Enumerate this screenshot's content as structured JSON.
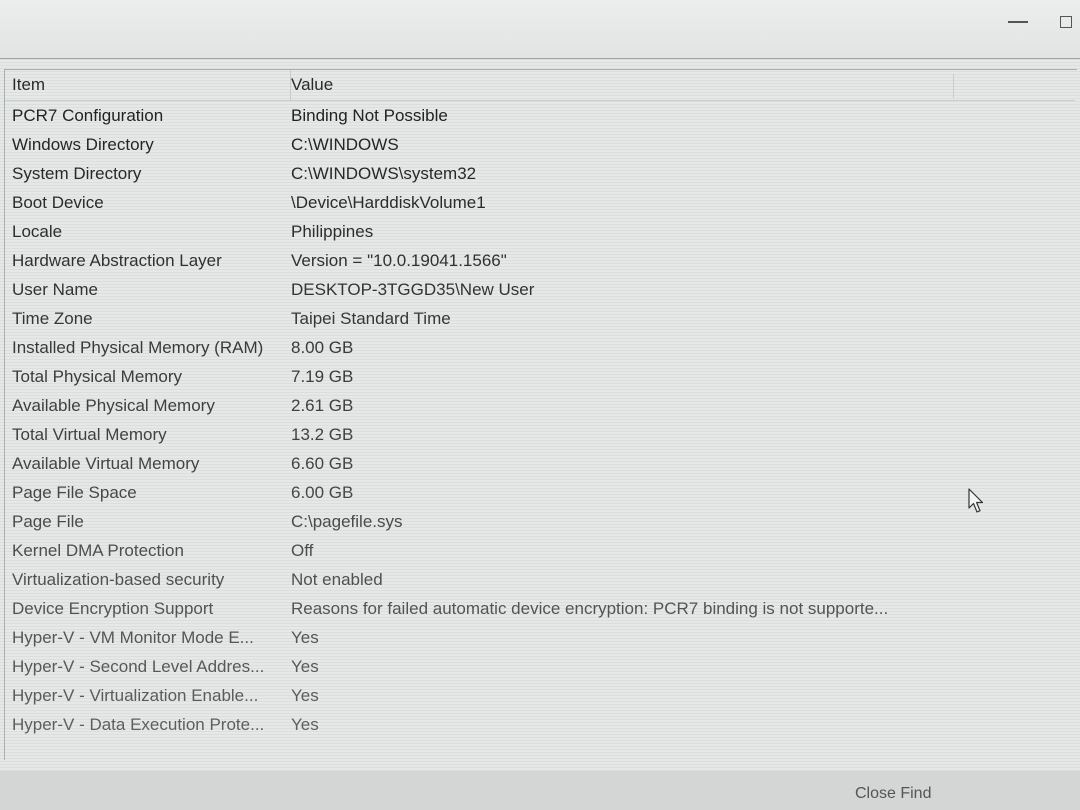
{
  "window": {
    "minimize_icon": "minimize-icon",
    "maximize_icon": "maximize-icon"
  },
  "table": {
    "columns": [
      "Item",
      "Value"
    ],
    "rows": [
      {
        "item": "PCR7 Configuration",
        "value": "Binding Not Possible"
      },
      {
        "item": "Windows Directory",
        "value": "C:\\WINDOWS"
      },
      {
        "item": "System Directory",
        "value": "C:\\WINDOWS\\system32"
      },
      {
        "item": "Boot Device",
        "value": "\\Device\\HarddiskVolume1"
      },
      {
        "item": "Locale",
        "value": "Philippines"
      },
      {
        "item": "Hardware Abstraction Layer",
        "value": "Version = \"10.0.19041.1566\""
      },
      {
        "item": "User Name",
        "value": "DESKTOP-3TGGD35\\New User"
      },
      {
        "item": "Time Zone",
        "value": "Taipei Standard Time"
      },
      {
        "item": "Installed Physical Memory (RAM)",
        "value": "8.00 GB"
      },
      {
        "item": "Total Physical Memory",
        "value": "7.19 GB"
      },
      {
        "item": "Available Physical Memory",
        "value": "2.61 GB"
      },
      {
        "item": "Total Virtual Memory",
        "value": "13.2 GB"
      },
      {
        "item": "Available Virtual Memory",
        "value": "6.60 GB"
      },
      {
        "item": "Page File Space",
        "value": "6.00 GB"
      },
      {
        "item": "Page File",
        "value": "C:\\pagefile.sys"
      },
      {
        "item": "Kernel DMA Protection",
        "value": "Off"
      },
      {
        "item": "Virtualization-based security",
        "value": "Not enabled"
      },
      {
        "item": "Device Encryption Support",
        "value": "Reasons for failed automatic device encryption: PCR7 binding is not supporte..."
      },
      {
        "item": "Hyper-V - VM Monitor Mode E...",
        "value": "Yes"
      },
      {
        "item": "Hyper-V - Second Level Addres...",
        "value": "Yes"
      },
      {
        "item": "Hyper-V - Virtualization Enable...",
        "value": "Yes"
      },
      {
        "item": "Hyper-V - Data Execution Prote...",
        "value": "Yes"
      }
    ]
  },
  "footer": {
    "close_find_label": "Close Find"
  },
  "cursor": {
    "icon": "mouse-pointer-icon"
  }
}
